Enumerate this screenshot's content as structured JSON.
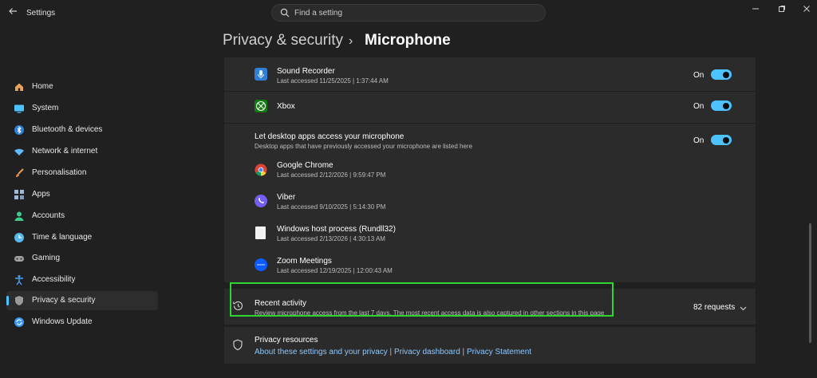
{
  "window": {
    "back_icon": "back-arrow-icon",
    "title": "Settings",
    "controls": [
      "minimize-icon",
      "maximize-icon",
      "close-icon"
    ]
  },
  "search": {
    "placeholder": "Find a setting",
    "icon": "search-icon"
  },
  "header": {
    "parent": "Privacy & security",
    "separator": "›",
    "current": "Microphone"
  },
  "sidebar": {
    "items": [
      {
        "label": "Home",
        "icon": "home-icon",
        "color": "#e8a55b"
      },
      {
        "label": "System",
        "icon": "monitor-icon",
        "color": "#4cc2ff"
      },
      {
        "label": "Bluetooth & devices",
        "icon": "bluetooth-icon",
        "color": "#4aa3f7"
      },
      {
        "label": "Network & internet",
        "icon": "wifi-icon",
        "color": "#60b8ff"
      },
      {
        "label": "Personalisation",
        "icon": "brush-icon",
        "color": "#e89d5b"
      },
      {
        "label": "Apps",
        "icon": "apps-icon",
        "color": "#9fb8d8"
      },
      {
        "label": "Accounts",
        "icon": "person-icon",
        "color": "#3fc98c"
      },
      {
        "label": "Time & language",
        "icon": "globe-clock-icon",
        "color": "#58b8f0"
      },
      {
        "label": "Gaming",
        "icon": "gamepad-icon",
        "color": "#a0a0a0"
      },
      {
        "label": "Accessibility",
        "icon": "accessibility-icon",
        "color": "#4aa3f7"
      },
      {
        "label": "Privacy & security",
        "icon": "shield-icon",
        "color": "#9a9a9a",
        "active": true
      },
      {
        "label": "Windows Update",
        "icon": "update-icon",
        "color": "#3a98f0"
      }
    ]
  },
  "apps": {
    "sound_recorder": {
      "name": "Sound Recorder",
      "last": "Last accessed 11/25/2025  |  1:37:44 AM",
      "state": "On"
    },
    "xbox": {
      "name": "Xbox",
      "state": "On"
    },
    "desktop": {
      "title": "Let desktop apps access your microphone",
      "subtitle": "Desktop apps that have previously accessed your microphone are listed here",
      "state": "On"
    },
    "chrome": {
      "name": "Google Chrome",
      "last": "Last accessed 2/12/2026  |  9:59:47 PM"
    },
    "viber": {
      "name": "Viber",
      "last": "Last accessed 9/10/2025  |  5:14:30 PM"
    },
    "host": {
      "name": "Windows host process (Rundll32)",
      "last": "Last accessed 2/13/2026  |  4:30:13 AM"
    },
    "zoom": {
      "name": "Zoom Meetings",
      "last": "Last accessed 12/19/2025  |  12:00:43 AM",
      "icon_text": "zoom"
    }
  },
  "recent": {
    "title": "Recent activity",
    "subtitle": "Review microphone access from the last 7 days. The most recent access data is also captured in other sections in this page",
    "count": "82 requests"
  },
  "resources": {
    "title": "Privacy resources",
    "links": [
      "About these settings and your privacy",
      "Privacy dashboard",
      "Privacy Statement"
    ],
    "sep": "|"
  },
  "colors": {
    "accent": "#4cc2ff",
    "highlight": "#2fd52f",
    "link": "#8cc8ff"
  }
}
